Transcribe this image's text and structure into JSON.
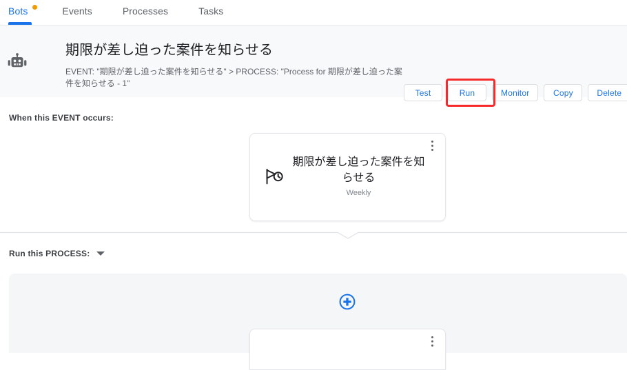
{
  "tabs": [
    {
      "label": "Bots",
      "active": true,
      "badge": "dot"
    },
    {
      "label": "Events",
      "active": false
    },
    {
      "label": "Processes",
      "active": false
    },
    {
      "label": "Tasks",
      "active": false
    }
  ],
  "bot_header": {
    "icon": "robot-icon",
    "title": "期限が差し迫った案件を知らせる",
    "subtitle": "EVENT: \"期限が差し迫った案件を知らせる\" > PROCESS: \"Process for 期限が差し迫った案件を知らせる - 1\"",
    "actions": [
      {
        "label": "Test",
        "name": "test-button"
      },
      {
        "label": "Run",
        "name": "run-button",
        "highlighted": true
      },
      {
        "label": "Monitor",
        "name": "monitor-button"
      },
      {
        "label": "Copy",
        "name": "copy-button"
      },
      {
        "label": "Delete",
        "name": "delete-button"
      }
    ]
  },
  "event_section": {
    "label": "When this EVENT occurs:",
    "card": {
      "icon": "flag-clock-icon",
      "title": "期限が差し迫った案件を知らせる",
      "subtitle": "Weekly",
      "menu_icon": "more-vert-icon"
    }
  },
  "process_section": {
    "label": "Run this PROCESS:",
    "dropdown_icon": "caret-down-icon",
    "add_icon": "add-circle-icon",
    "card": {
      "menu_icon": "more-vert-icon"
    }
  },
  "colors": {
    "accent": "#1a73e8",
    "badge": "#f29900",
    "highlight": "#f62a2a",
    "header_bg": "#f8f9fa",
    "panel_bg": "#f5f6f8"
  }
}
